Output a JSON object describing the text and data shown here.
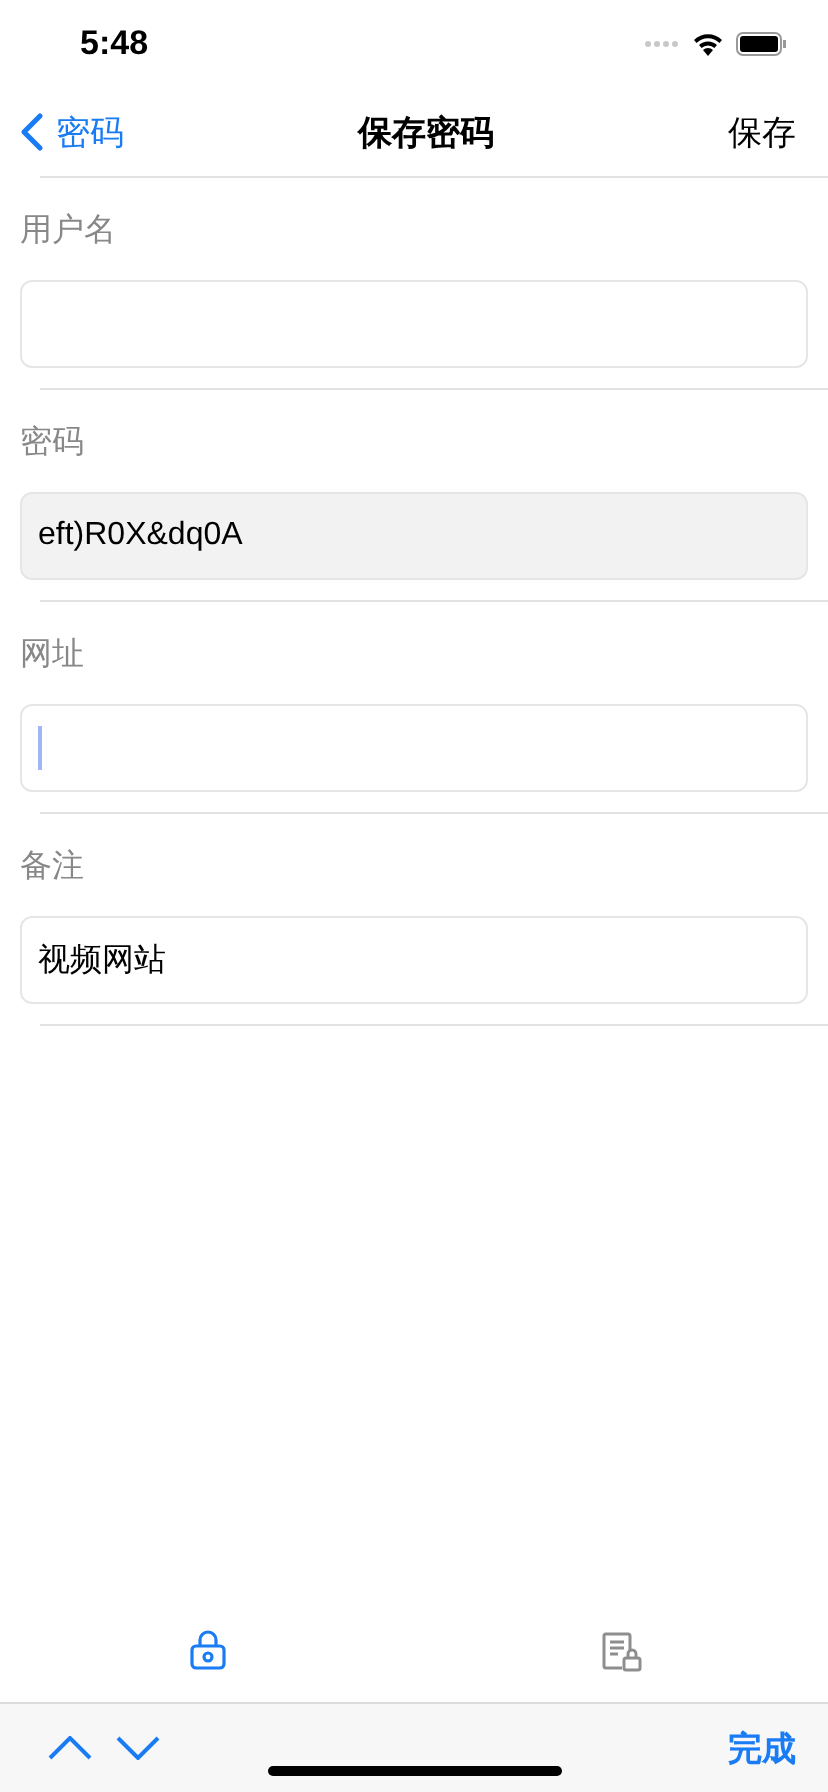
{
  "status_bar": {
    "time": "5:48"
  },
  "nav": {
    "back": "密码",
    "title": "保存密码",
    "action": "保存"
  },
  "fields": [
    {
      "label": "用户名",
      "readonly": false,
      "focused": false
    },
    {
      "label": "密码",
      "value": "eft)R0X&dq0A",
      "readonly": true,
      "focused": false
    },
    {
      "label": "网址",
      "readonly": false,
      "focused": true
    },
    {
      "label": "备注",
      "value": "视频网站",
      "readonly": false,
      "focused": false
    }
  ],
  "tab_bar": {
    "items": [
      {
        "kind": "lock",
        "selected": true
      },
      {
        "kind": "document",
        "selected": false
      }
    ]
  },
  "keyboard_toolbar": {
    "done": "完成"
  }
}
